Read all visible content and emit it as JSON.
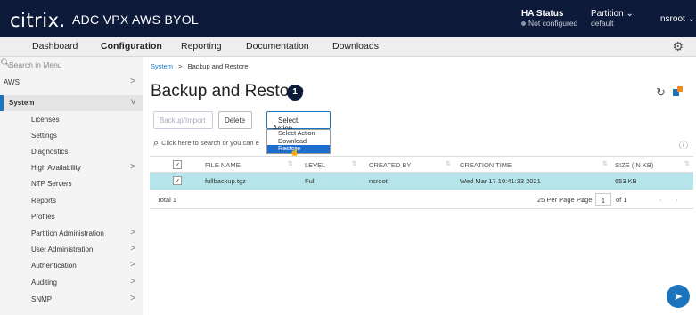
{
  "header": {
    "brand": "citrix.",
    "app_title": "ADC VPX AWS BYOL",
    "ha_label": "HA Status",
    "ha_value": "Not configured",
    "partition_label": "Partition",
    "partition_value": "default",
    "user": "nsroot"
  },
  "nav": [
    "Dashboard",
    "Configuration",
    "Reporting",
    "Documentation",
    "Downloads"
  ],
  "sidebar": {
    "search_placeholder": "Search in Menu",
    "items": [
      {
        "label": "AWS",
        "chevron": ">"
      },
      {
        "label": "System",
        "chevron": "v"
      },
      {
        "label": "Licenses"
      },
      {
        "label": "Settings"
      },
      {
        "label": "Diagnostics"
      },
      {
        "label": "High Availability",
        "chevron": ">"
      },
      {
        "label": "NTP Servers"
      },
      {
        "label": "Reports"
      },
      {
        "label": "Profiles"
      },
      {
        "label": "Partition Administration",
        "chevron": ">"
      },
      {
        "label": "User Administration",
        "chevron": ">"
      },
      {
        "label": "Authentication",
        "chevron": ">"
      },
      {
        "label": "Auditing",
        "chevron": ">"
      },
      {
        "label": "SNMP",
        "chevron": ">"
      }
    ]
  },
  "breadcrumb": {
    "root": "System",
    "sep": ">",
    "current": "Backup and Restore"
  },
  "page": {
    "title": "Backup and Restore",
    "count": "1"
  },
  "toolbar": {
    "backup_import": "Backup/Import",
    "delete": "Delete",
    "select_action": "Select Action"
  },
  "action_menu": [
    "Select Action",
    "Download",
    "Restore"
  ],
  "table_search": "Click here to search or you can e",
  "table": {
    "headers": [
      "FILE NAME",
      "LEVEL",
      "CREATED BY",
      "CREATION TIME",
      "SIZE (IN KB)"
    ],
    "rows": [
      [
        "fullbackup.tgz",
        "Full",
        "nsroot",
        "Wed Mar 17 10:41:33 2021",
        "653 KB"
      ]
    ]
  },
  "footer": {
    "total": "Total 1",
    "per_page": "25 Per Page",
    "page_label": "Page",
    "page_value": "1",
    "of": "of 1"
  },
  "colors": {
    "topbar": "#0e1a3a",
    "accent": "#1c75bc",
    "row_selected": "#b5e5ea"
  }
}
